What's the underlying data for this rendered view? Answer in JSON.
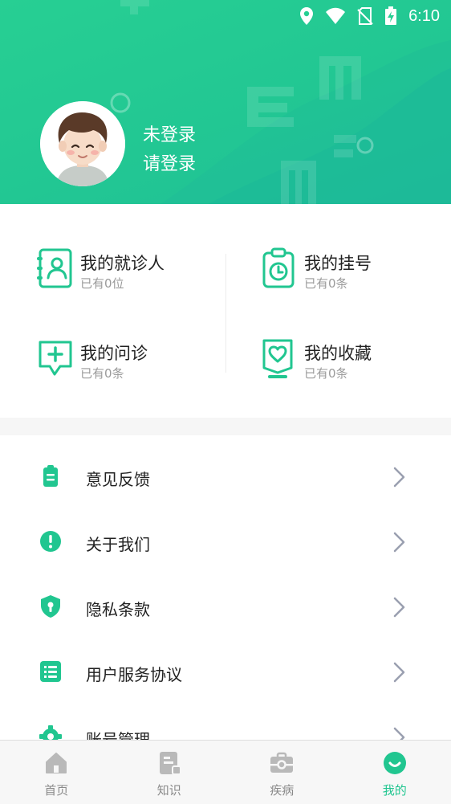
{
  "status_bar": {
    "time": "6:10"
  },
  "profile": {
    "status": "未登录",
    "prompt": "请登录"
  },
  "quick_items": [
    {
      "title": "我的就诊人",
      "subtitle": "已有0位",
      "icon": "patient-card-icon"
    },
    {
      "title": "我的挂号",
      "subtitle": "已有0条",
      "icon": "clipboard-clock-icon"
    },
    {
      "title": "我的问诊",
      "subtitle": "已有0条",
      "icon": "chat-plus-icon"
    },
    {
      "title": "我的收藏",
      "subtitle": "已有0条",
      "icon": "heart-bookmark-icon"
    }
  ],
  "menu_items": [
    {
      "label": "意见反馈",
      "icon": "feedback-icon"
    },
    {
      "label": "关于我们",
      "icon": "info-icon"
    },
    {
      "label": "隐私条款",
      "icon": "privacy-shield-icon"
    },
    {
      "label": "用户服务协议",
      "icon": "agreement-icon"
    },
    {
      "label": "账号管理",
      "icon": "settings-icon"
    }
  ],
  "tabs": [
    {
      "label": "首页",
      "icon": "home-icon"
    },
    {
      "label": "知识",
      "icon": "knowledge-icon"
    },
    {
      "label": "疾病",
      "icon": "disease-icon"
    },
    {
      "label": "我的",
      "icon": "profile-icon",
      "active": true
    }
  ],
  "colors": {
    "primary": "#21c690",
    "text": "#222222",
    "subtext": "#9a9a9a",
    "chevron": "#9a9fb0"
  }
}
